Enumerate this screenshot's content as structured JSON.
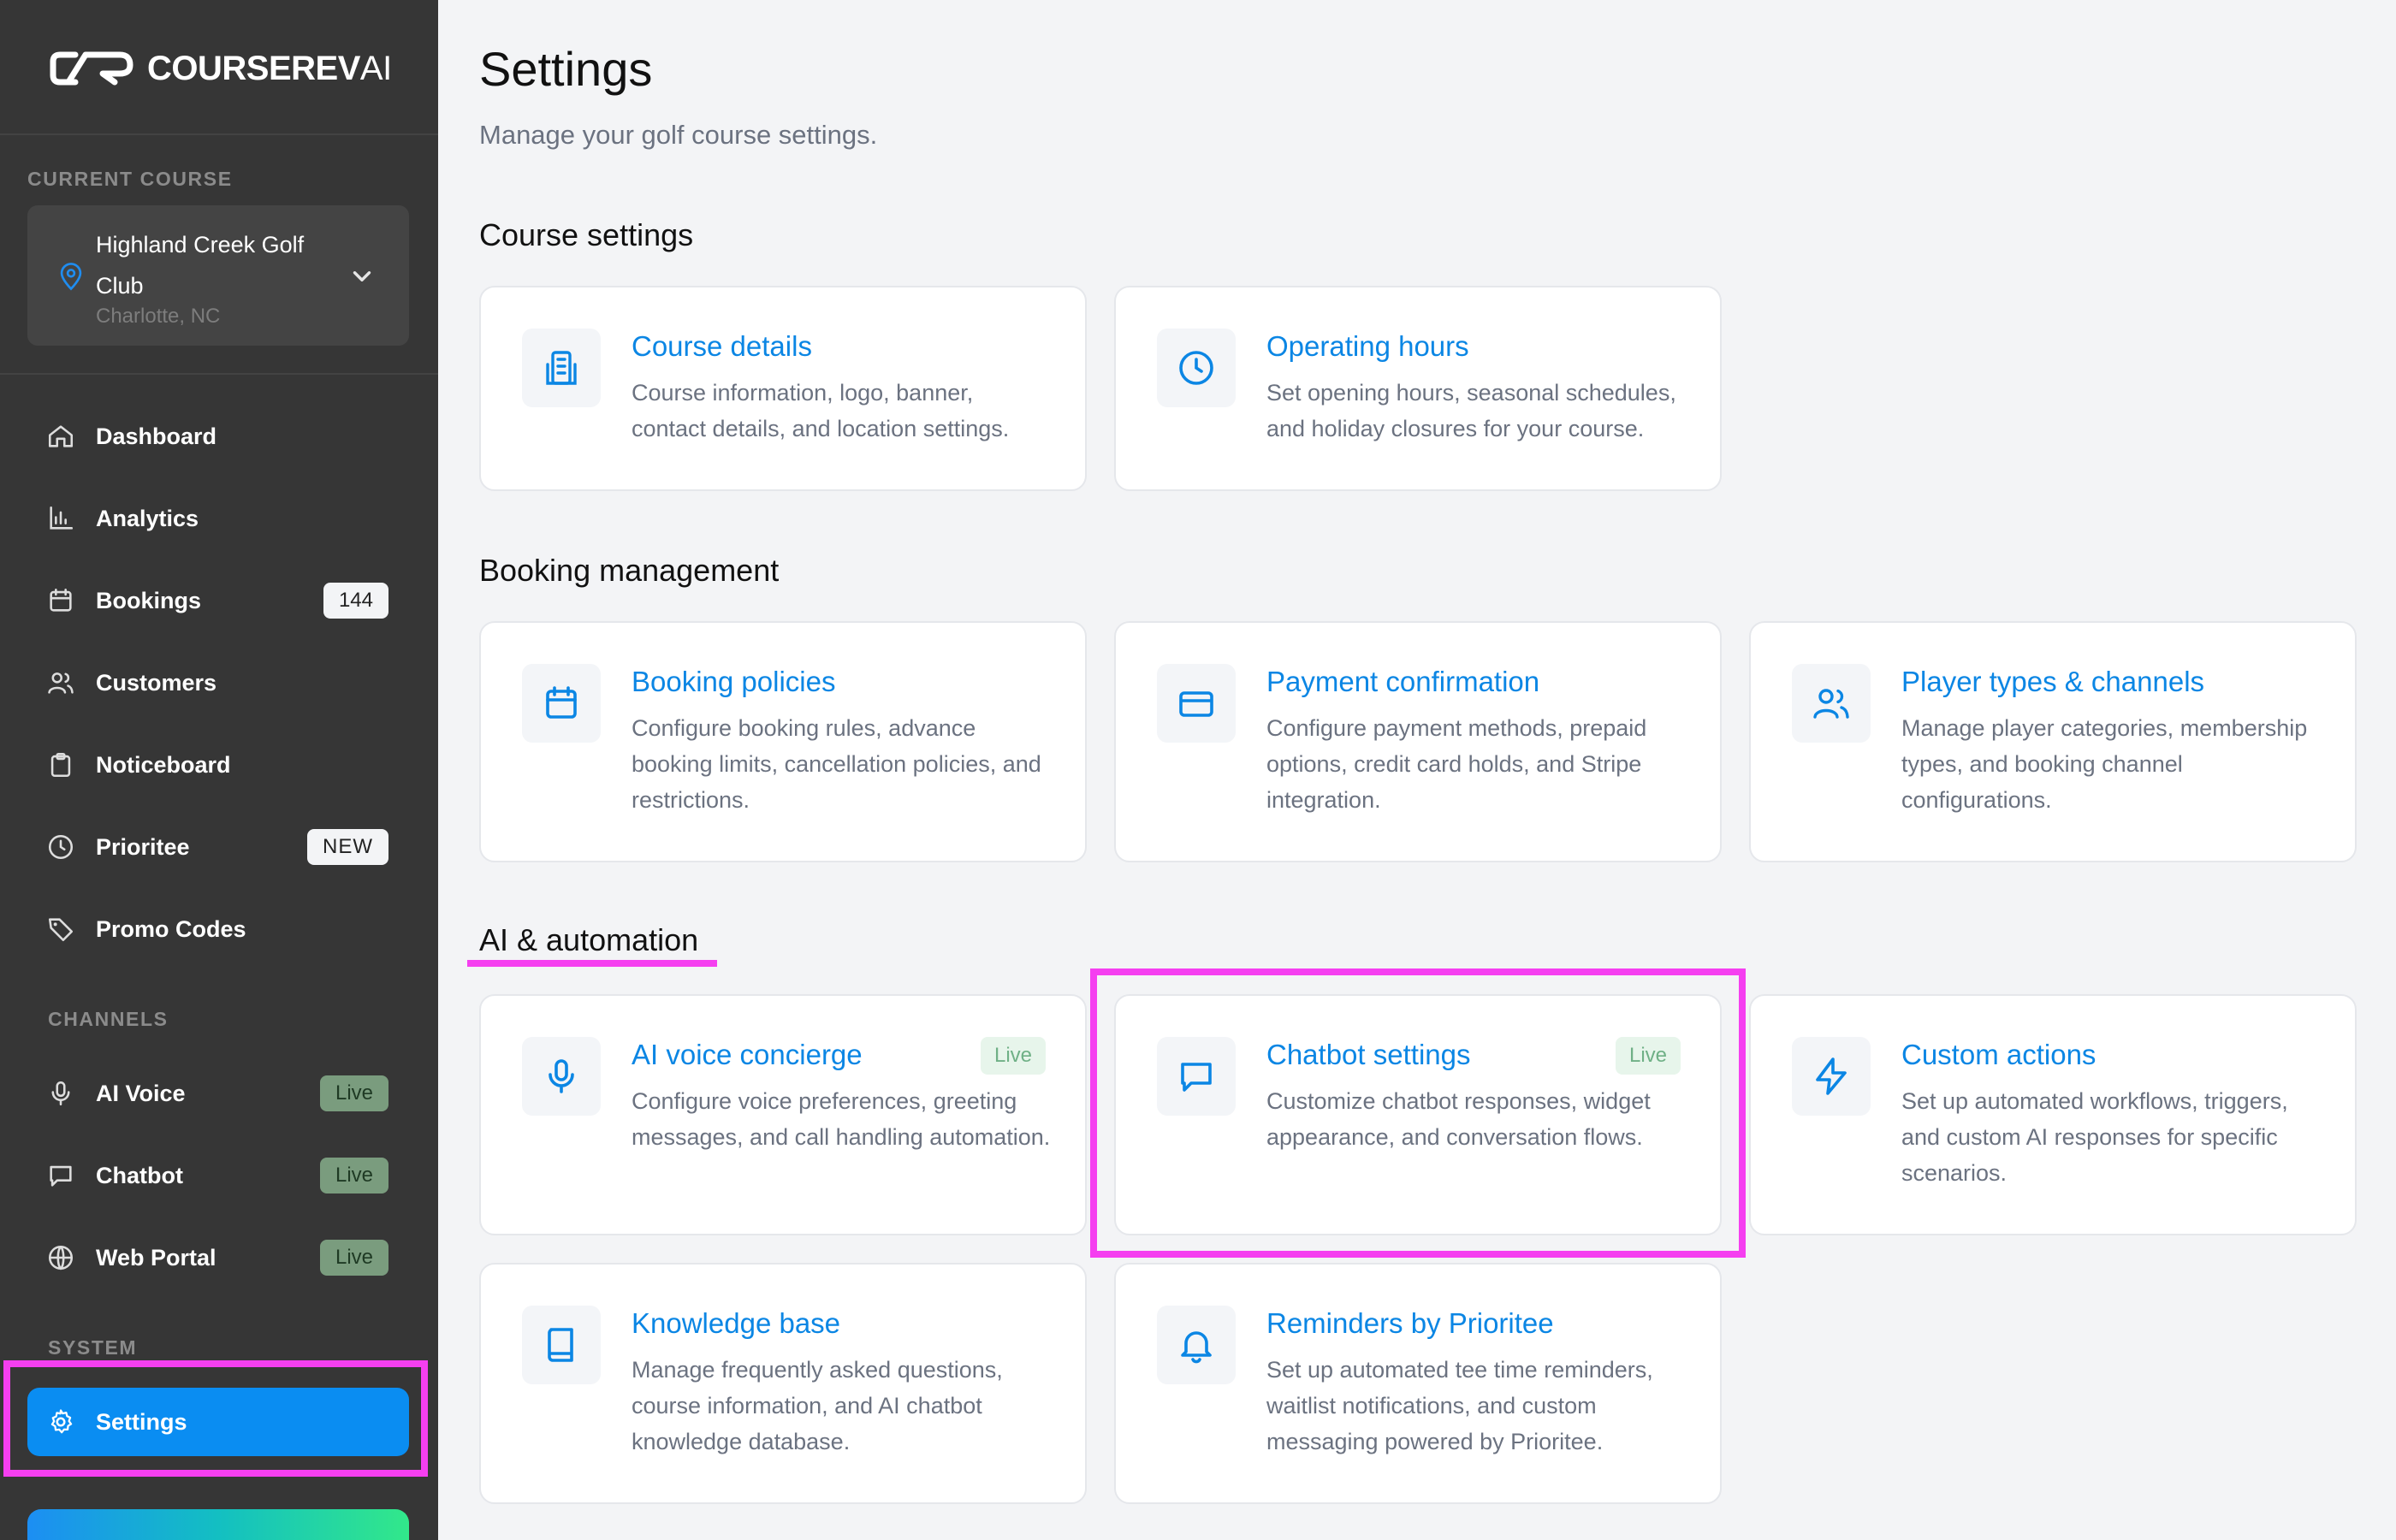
{
  "brand": {
    "name_main": "COURSEREV",
    "name_suffix": "AI"
  },
  "sidebar": {
    "current_course_label": "CURRENT COURSE",
    "course": {
      "name": "Highland Creek Golf Club",
      "location": "Charlotte, NC"
    },
    "nav": [
      {
        "label": "Dashboard",
        "icon": "home-icon"
      },
      {
        "label": "Analytics",
        "icon": "bar-chart-icon"
      },
      {
        "label": "Bookings",
        "icon": "calendar-icon",
        "badge": "144"
      },
      {
        "label": "Customers",
        "icon": "users-icon"
      },
      {
        "label": "Noticeboard",
        "icon": "clipboard-icon"
      },
      {
        "label": "Prioritee",
        "icon": "clock-icon",
        "badge": "NEW"
      },
      {
        "label": "Promo Codes",
        "icon": "tag-icon"
      }
    ],
    "channels_label": "CHANNELS",
    "channels": [
      {
        "label": "AI Voice",
        "icon": "microphone-icon",
        "badge": "Live"
      },
      {
        "label": "Chatbot",
        "icon": "chat-icon",
        "badge": "Live"
      },
      {
        "label": "Web Portal",
        "icon": "globe-icon",
        "badge": "Live"
      }
    ],
    "system_label": "SYSTEM",
    "system": [
      {
        "label": "Settings",
        "icon": "gear-icon",
        "active": true
      }
    ]
  },
  "main": {
    "title": "Settings",
    "subtitle": "Manage your golf course settings.",
    "sections": [
      {
        "title": "Course settings",
        "cards": [
          {
            "title": "Course details",
            "desc": "Course information, logo, banner, contact details, and location settings.",
            "icon": "building-icon"
          },
          {
            "title": "Operating hours",
            "desc": "Set opening hours, seasonal schedules, and holiday closures for your course.",
            "icon": "clock-icon"
          }
        ]
      },
      {
        "title": "Booking management",
        "cards": [
          {
            "title": "Booking policies",
            "desc": "Configure booking rules, advance booking limits, cancellation policies, and restrictions.",
            "icon": "calendar-icon"
          },
          {
            "title": "Payment confirmation",
            "desc": "Configure payment methods, prepaid options, credit card holds, and Stripe integration.",
            "icon": "credit-card-icon"
          },
          {
            "title": "Player types & channels",
            "desc": "Manage player categories, membership types, and booking channel configurations.",
            "icon": "users-icon"
          }
        ]
      },
      {
        "title": "AI & automation",
        "cards": [
          {
            "title": "AI voice concierge",
            "desc": "Configure voice preferences, greeting messages, and call handling automation.",
            "icon": "microphone-icon",
            "badge": "Live"
          },
          {
            "title": "Chatbot settings",
            "desc": "Customize chatbot responses, widget appearance, and conversation flows.",
            "icon": "chat-icon",
            "badge": "Live"
          },
          {
            "title": "Custom actions",
            "desc": "Set up automated workflows, triggers, and custom AI responses for specific scenarios.",
            "icon": "lightning-icon"
          },
          {
            "title": "Knowledge base",
            "desc": "Manage frequently asked questions, course information, and AI chatbot knowledge database.",
            "icon": "book-icon"
          },
          {
            "title": "Reminders by Prioritee",
            "desc": "Set up automated tee time reminders, waitlist notifications, and custom messaging powered by Prioritee.",
            "icon": "bell-icon"
          }
        ]
      }
    ]
  },
  "colors": {
    "sidebar_bg": "#363636",
    "accent": "#0b86e4",
    "active_nav": "#0a8df2",
    "highlight": "#f53ff0",
    "live_badge": "#e7f5eb"
  }
}
